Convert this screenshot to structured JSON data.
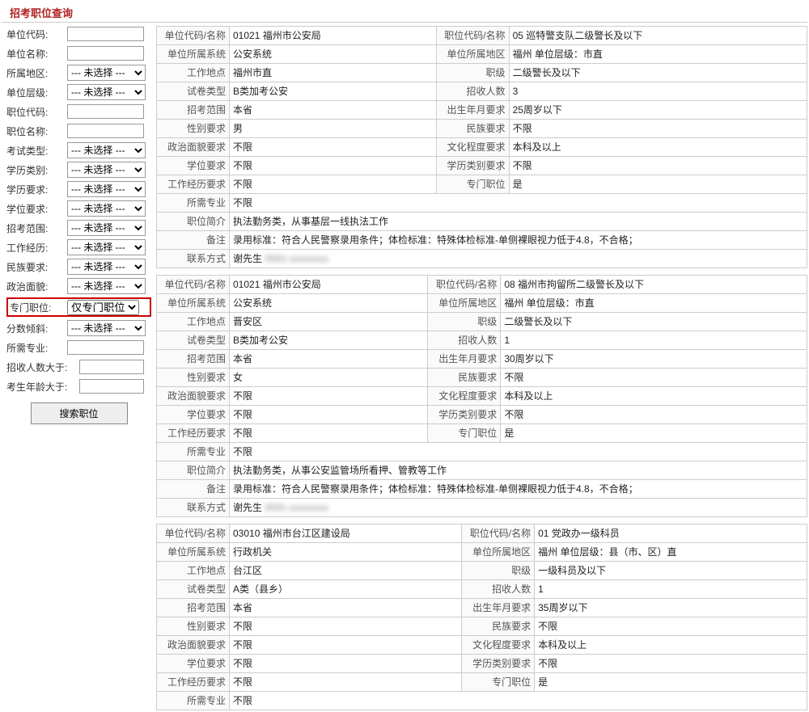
{
  "title": "招考职位查询",
  "sidebar": {
    "unit_code_label": "单位代码:",
    "unit_name_label": "单位名称:",
    "region_label": "所属地区:",
    "unit_level_label": "单位层级:",
    "pos_code_label": "职位代码:",
    "pos_name_label": "职位名称:",
    "exam_type_label": "考试类型:",
    "edu_cat_label": "学历类别:",
    "edu_req_label": "学历要求:",
    "degree_req_label": "学位要求:",
    "recruit_range_label": "招考范围:",
    "work_exp_label": "工作经历:",
    "ethnic_req_label": "民族要求:",
    "politics_label": "政治面貌:",
    "special_pos_label": "专门职位:",
    "score_tilt_label": "分数倾斜:",
    "major_label": "所需专业:",
    "recruit_num_label": "招收人数大于:",
    "age_label": "考生年龄大于:",
    "unselected_opt": "--- 未选择 ---",
    "special_opt": "仅专门职位",
    "search_btn": "搜索职位"
  },
  "field_labels": {
    "unit_code_name": "单位代码/名称",
    "pos_code_name": "职位代码/名称",
    "unit_system": "单位所属系统",
    "unit_region": "单位所属地区",
    "work_loc": "工作地点",
    "rank": "职级",
    "exam_type": "试卷类型",
    "recruit_num": "招收人数",
    "recruit_range": "招考范围",
    "birth_req": "出生年月要求",
    "gender_req": "性别要求",
    "ethnic_req": "民族要求",
    "politics_req": "政治面貌要求",
    "edu_req": "文化程度要求",
    "degree_req": "学位要求",
    "edu_cat_req": "学历类别要求",
    "work_exp_req": "工作经历要求",
    "special_pos": "专门职位",
    "major_req": "所需专业",
    "pos_desc": "职位简介",
    "remark": "备注",
    "contact": "联系方式"
  },
  "jobs": [
    {
      "unit_code_name": "01021 福州市公安局",
      "pos_code_name": "05 巡特警支队二级警长及以下",
      "unit_system": "公安系统",
      "unit_region": "福州   单位层级：市直",
      "work_loc": "福州市直",
      "rank": "二级警长及以下",
      "exam_type": "B类加考公安",
      "recruit_num": "3",
      "recruit_range": "本省",
      "birth_req": "25周岁以下",
      "gender_req": "男",
      "ethnic_req": "不限",
      "politics_req": "不限",
      "edu_req": "本科及以上",
      "degree_req": "不限",
      "edu_cat_req": "不限",
      "work_exp_req": "不限",
      "special_pos": "是",
      "major_req": "不限",
      "pos_desc": "执法勤务类，从事基层一线执法工作",
      "remark": "录用标准：符合人民警察录用条件；体检标准：特殊体检标准-单侧裸眼视力低于4.8，不合格；",
      "contact_name": "谢先生",
      "contact_blur": "0591-xxxxxxxx"
    },
    {
      "unit_code_name": "01021 福州市公安局",
      "pos_code_name": "08 福州市拘留所二级警长及以下",
      "unit_system": "公安系统",
      "unit_region": "福州   单位层级：市直",
      "work_loc": "晋安区",
      "rank": "二级警长及以下",
      "exam_type": "B类加考公安",
      "recruit_num": "1",
      "recruit_range": "本省",
      "birth_req": "30周岁以下",
      "gender_req": "女",
      "ethnic_req": "不限",
      "politics_req": "不限",
      "edu_req": "本科及以上",
      "degree_req": "不限",
      "edu_cat_req": "不限",
      "work_exp_req": "不限",
      "special_pos": "是",
      "major_req": "不限",
      "pos_desc": "执法勤务类，从事公安监管场所看押、管教等工作",
      "remark": "录用标准：符合人民警察录用条件；体检标准：特殊体检标准-单侧裸眼视力低于4.8，不合格；",
      "contact_name": "谢先生",
      "contact_blur": "0591-xxxxxxxx"
    },
    {
      "unit_code_name": "03010 福州市台江区建设局",
      "pos_code_name": "01 党政办一级科员",
      "unit_system": "行政机关",
      "unit_region": "福州   单位层级：县（市、区）直",
      "work_loc": "台江区",
      "rank": "一级科员及以下",
      "exam_type": "A类（县乡）",
      "recruit_num": "1",
      "recruit_range": "本省",
      "birth_req": "35周岁以下",
      "gender_req": "不限",
      "ethnic_req": "不限",
      "politics_req": "不限",
      "edu_req": "本科及以上",
      "degree_req": "不限",
      "edu_cat_req": "不限",
      "work_exp_req": "不限",
      "special_pos": "是",
      "major_req": "不限"
    }
  ]
}
